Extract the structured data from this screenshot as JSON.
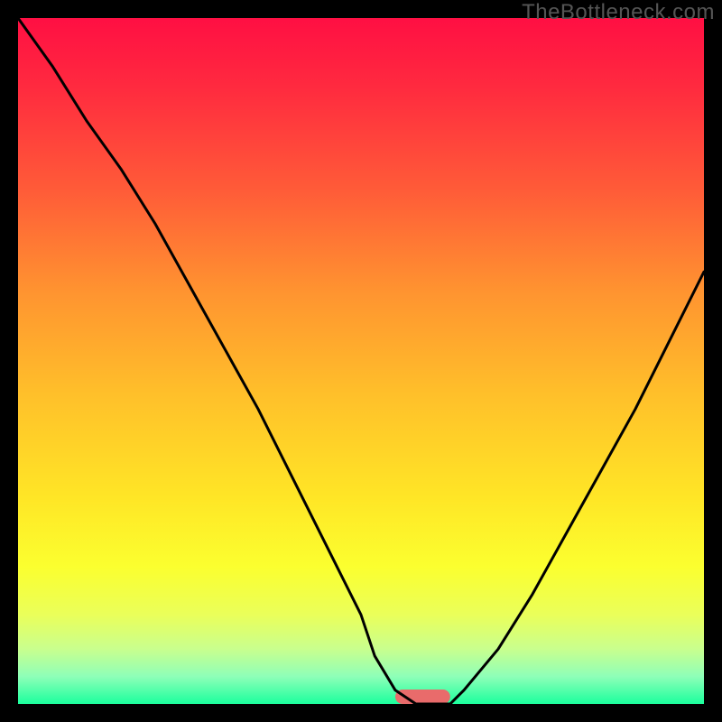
{
  "watermark": "TheBottleneck.com",
  "chart_data": {
    "type": "line",
    "title": "",
    "xlabel": "",
    "ylabel": "",
    "xlim": [
      0,
      100
    ],
    "ylim": [
      0,
      100
    ],
    "grid": false,
    "legend": false,
    "series": [
      {
        "name": "curve",
        "x": [
          0,
          5,
          10,
          15,
          20,
          25,
          30,
          35,
          40,
          45,
          50,
          52,
          55,
          58,
          60,
          63,
          65,
          70,
          75,
          80,
          85,
          90,
          95,
          100
        ],
        "y": [
          100,
          93,
          85,
          78,
          70,
          61,
          52,
          43,
          33,
          23,
          13,
          7,
          2,
          0,
          0,
          0,
          2,
          8,
          16,
          25,
          34,
          43,
          53,
          63
        ]
      }
    ],
    "gradient_stops": [
      {
        "offset": 0.0,
        "color": "#ff0f43"
      },
      {
        "offset": 0.1,
        "color": "#ff2a3f"
      },
      {
        "offset": 0.25,
        "color": "#ff5b38"
      },
      {
        "offset": 0.4,
        "color": "#ff9430"
      },
      {
        "offset": 0.55,
        "color": "#ffc02a"
      },
      {
        "offset": 0.7,
        "color": "#ffe626"
      },
      {
        "offset": 0.8,
        "color": "#fbff2f"
      },
      {
        "offset": 0.87,
        "color": "#eaff5a"
      },
      {
        "offset": 0.92,
        "color": "#c9ff8e"
      },
      {
        "offset": 0.96,
        "color": "#8effb8"
      },
      {
        "offset": 1.0,
        "color": "#1bff9d"
      }
    ],
    "indicator": {
      "x_center": 59,
      "width": 8,
      "color": "#e96b6b"
    }
  }
}
